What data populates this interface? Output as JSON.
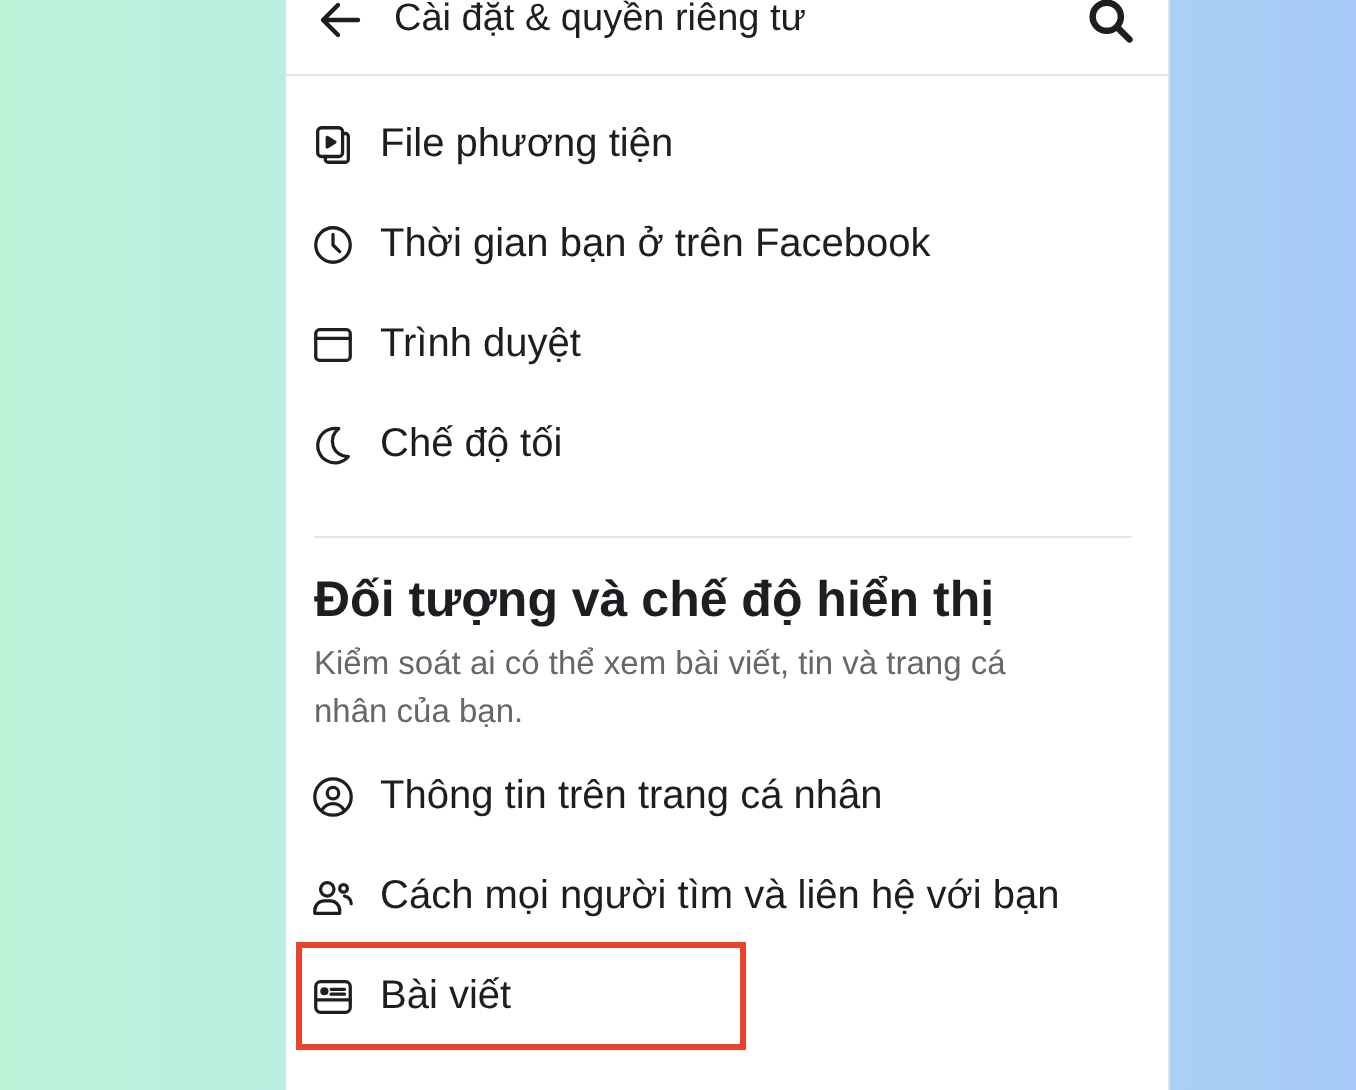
{
  "header": {
    "title": "Cài đặt & quyền riêng tư"
  },
  "preferences": [
    {
      "label": "File phương tiện",
      "highlighted": false
    },
    {
      "label": "Thời gian bạn ở trên Facebook",
      "highlighted": false
    },
    {
      "label": "Trình duyệt",
      "highlighted": false
    },
    {
      "label": "Chế độ tối",
      "highlighted": false
    }
  ],
  "audience_section": {
    "heading": "Đối tượng và chế độ hiển thị",
    "description": "Kiểm soát ai có thể xem bài viết, tin và trang cá nhân của bạn.",
    "items": [
      {
        "label": "Thông tin trên trang cá nhân",
        "highlighted": false
      },
      {
        "label": "Cách mọi người tìm và liên hệ với bạn",
        "highlighted": false
      },
      {
        "label": "Bài viết",
        "highlighted": true
      }
    ]
  }
}
